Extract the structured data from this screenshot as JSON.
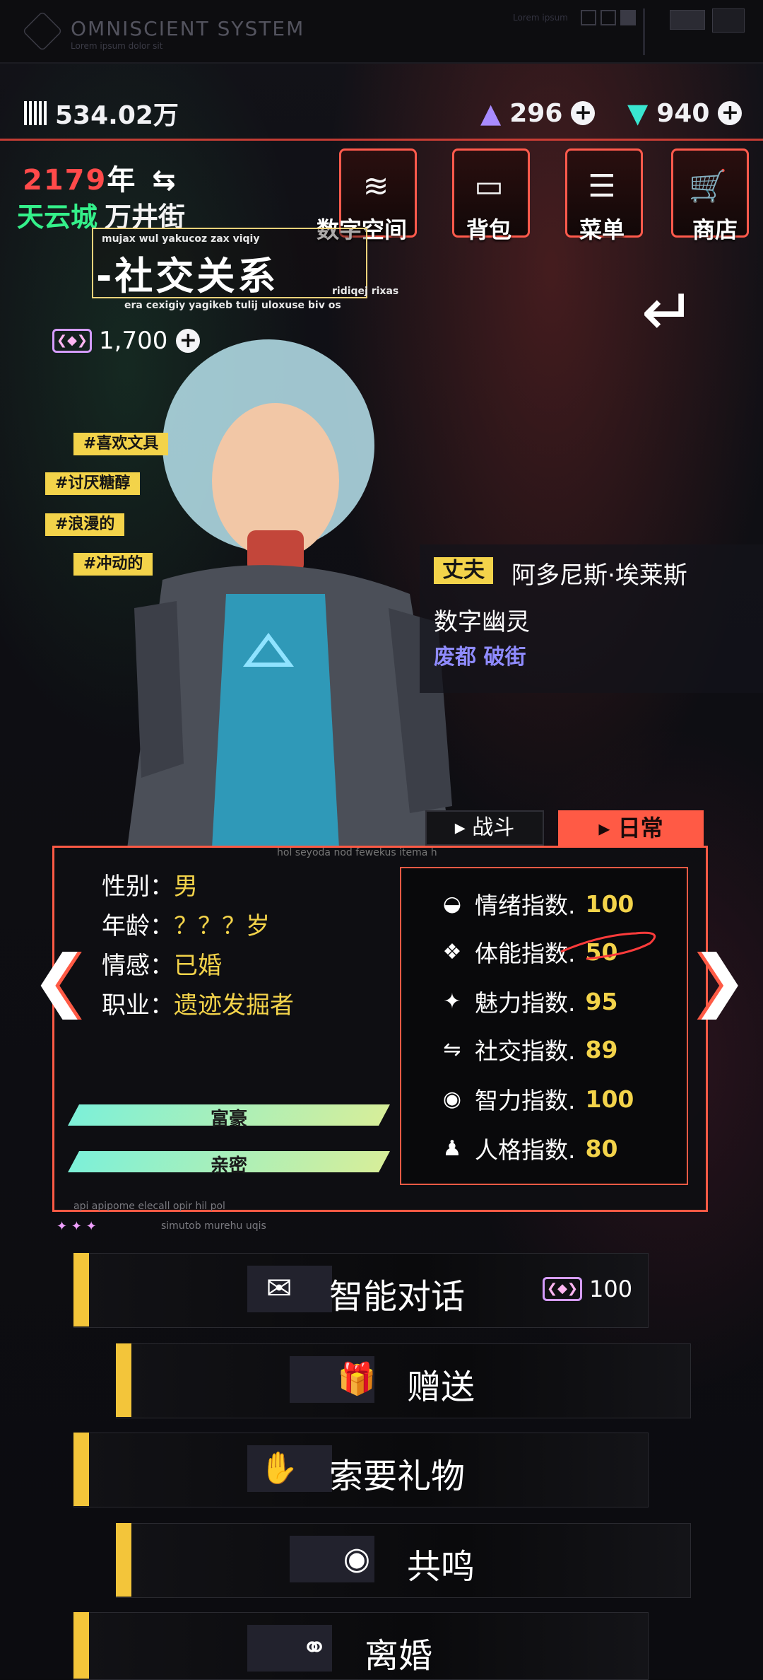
{
  "app": {
    "name": "OMNISCIENT SYSTEM",
    "subtitle": "Lorem ipsum dolor sit",
    "top_small": "Lorem ipsum"
  },
  "resources": {
    "money": "534.02万",
    "crystal_purple": "296",
    "crystal_teal": "940",
    "coin": "1,700",
    "plus_symbol": "+"
  },
  "location": {
    "year_number": "2179",
    "year_suffix": "年",
    "city": "天云城",
    "street": "万井街"
  },
  "top_nav": [
    {
      "label": "数字空间",
      "icon": "layers-icon",
      "glyph": "≋"
    },
    {
      "label": "背包",
      "icon": "bag-icon",
      "glyph": "▭"
    },
    {
      "label": "菜单",
      "icon": "list-icon",
      "glyph": "☰"
    },
    {
      "label": "商店",
      "icon": "cart-icon",
      "glyph": "🛒"
    }
  ],
  "page": {
    "title": "-社交关系",
    "lorem_top": "mujax wul yakucoz zax viqiy",
    "lorem_right": "ridiqej rixas",
    "lorem_bottom": "era cexigiy yagikeb tulij uloxuse biv os",
    "back_label": "↵"
  },
  "tags": [
    "#喜欢文具",
    "#讨厌糖醇",
    "#浪漫的",
    "#冲动的"
  ],
  "spouse": {
    "tag": "丈夫",
    "name": "阿多尼斯·埃莱斯",
    "role": "数字幽灵",
    "place": "废都 破街"
  },
  "tabs": {
    "battle": "战斗",
    "daily": "日常"
  },
  "profile": {
    "panel_caption": "hol seyoda nod fewekus itema h",
    "gender_label": "性别：",
    "gender": "男",
    "age_label": "年龄：",
    "age": "？？？岁",
    "emotion_label": "情感：",
    "emotion": "已婚",
    "job_label": "职业：",
    "job": "遗迹发掘者"
  },
  "stats": [
    {
      "label": "情绪指数.",
      "value": "100",
      "icon": "mood-icon",
      "glyph": "◒"
    },
    {
      "label": "体能指数.",
      "value": "50",
      "icon": "stamina-icon",
      "glyph": "❖"
    },
    {
      "label": "魅力指数.",
      "value": "95",
      "icon": "sparkle-icon",
      "glyph": "✦"
    },
    {
      "label": "社交指数.",
      "value": "89",
      "icon": "social-icon",
      "glyph": "⇋"
    },
    {
      "label": "智力指数.",
      "value": "100",
      "icon": "eye-brain-icon",
      "glyph": "◉"
    },
    {
      "label": "人格指数.",
      "value": "80",
      "icon": "person-icon",
      "glyph": "♟"
    }
  ],
  "relationship": {
    "bar1": "富豪",
    "bar2": "亲密",
    "bar1_level": 1.0,
    "bar2_level": 1.0
  },
  "footer_lorem": {
    "line1": "api apipome elecall opir hil pol",
    "line2": "simutob murehu uqis"
  },
  "actions": [
    {
      "label": "智能对话",
      "icon": "chat-icon",
      "glyph": "✉",
      "cost": "100"
    },
    {
      "label": "赠送",
      "icon": "gift-icon",
      "glyph": "🎁"
    },
    {
      "label": "索要礼物",
      "icon": "hand-gift-icon",
      "glyph": "✋"
    },
    {
      "label": "共鸣",
      "icon": "eye-icon",
      "glyph": "◉"
    },
    {
      "label": "离婚",
      "icon": "broken-ring-icon",
      "glyph": "⚭"
    }
  ],
  "colors": {
    "accent_red": "#ff5a45",
    "accent_yellow": "#f3d34a",
    "accent_green": "#34f08a",
    "accent_purple": "#8f8bff"
  }
}
